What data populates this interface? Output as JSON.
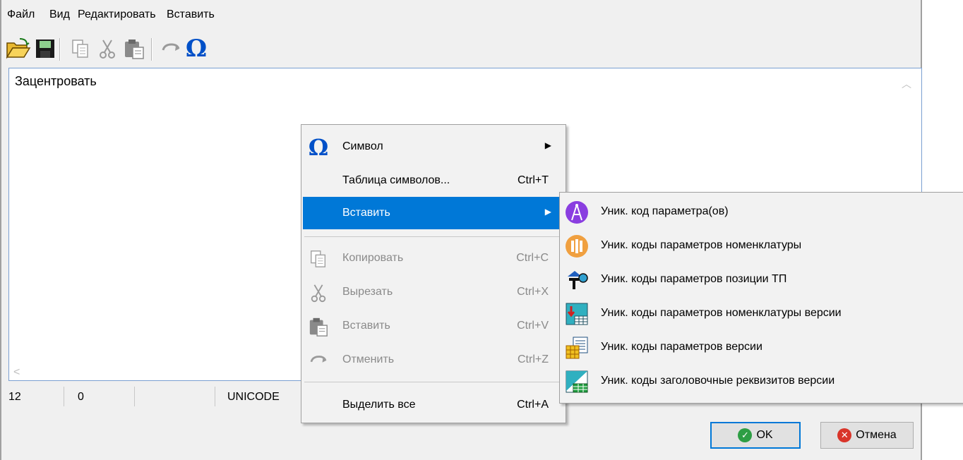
{
  "menu": {
    "file": "Файл",
    "view": "Вид",
    "edit": "Редактировать",
    "insert": "Вставить"
  },
  "toolbar": {
    "icons": [
      "open-folder-icon",
      "save-icon",
      "copy-icon",
      "cut-icon",
      "paste-icon",
      "undo-icon",
      "omega-icon"
    ],
    "omega": "Ω"
  },
  "editor": {
    "text": "Зацентровать"
  },
  "status": {
    "line": "12",
    "col": "0",
    "encoding": "UNICODE"
  },
  "buttons": {
    "ok": "OK",
    "cancel": "Отмена"
  },
  "context_menu": {
    "symbol": "Символ",
    "symbol_table": "Таблица символов...",
    "symbol_table_shortcut": "Ctrl+T",
    "insert": "Вставить",
    "copy": "Копировать",
    "copy_shortcut": "Ctrl+C",
    "cut": "Вырезать",
    "cut_shortcut": "Ctrl+X",
    "paste": "Вставить",
    "paste_shortcut": "Ctrl+V",
    "undo": "Отменить",
    "undo_shortcut": "Ctrl+Z",
    "select_all": "Выделить все",
    "select_all_shortcut": "Ctrl+A"
  },
  "submenu": {
    "items": [
      "Уник. код параметра(ов)",
      "Уник. коды параметров номенклатуры",
      "Уник. коды параметров позиции ТП",
      "Уник. коды параметров номенклатуры версии",
      "Уник. коды параметров версии",
      "Уник. коды заголовочные реквизитов версии"
    ]
  },
  "colors": {
    "accent": "#0078d7",
    "ok_green": "#2e9e44",
    "cancel_red": "#d9352a",
    "omega_blue": "#0050c8"
  }
}
